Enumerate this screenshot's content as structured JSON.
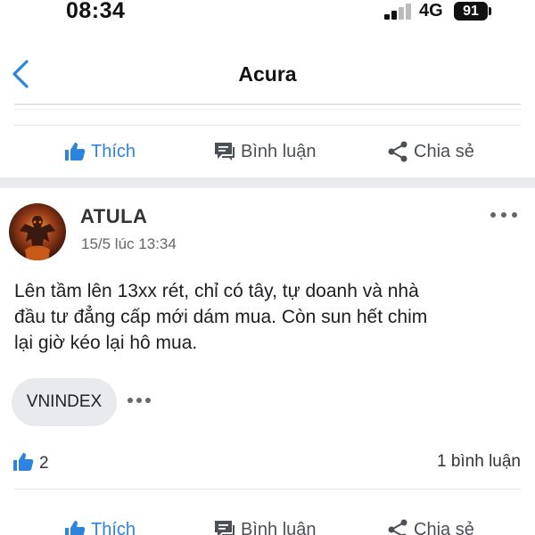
{
  "status_bar": {
    "time": "08:34",
    "network": "4G",
    "battery": "91"
  },
  "header": {
    "title": "Acura",
    "back_icon": "chevron-left-icon"
  },
  "actions": {
    "like_label": "Thích",
    "comment_label": "Bình luận",
    "share_label": "Chia sẻ"
  },
  "post": {
    "author": "ATULA",
    "timestamp": "15/5 lúc 13:34",
    "body_lines": [
      "Lên tầm lên 13xx rét, chỉ có tây, tự doanh và nhà",
      "đầu tư đẳng cấp mới dám mua. Còn sun hết chim",
      "lại giờ kéo lại hô mua."
    ],
    "tag": "VNINDEX",
    "like_count": "2",
    "comment_count": "1 bình luận"
  },
  "colors": {
    "accent": "#2d83e0",
    "text": "#1c1e21",
    "muted": "#666666",
    "separator": "#e9ebee"
  }
}
